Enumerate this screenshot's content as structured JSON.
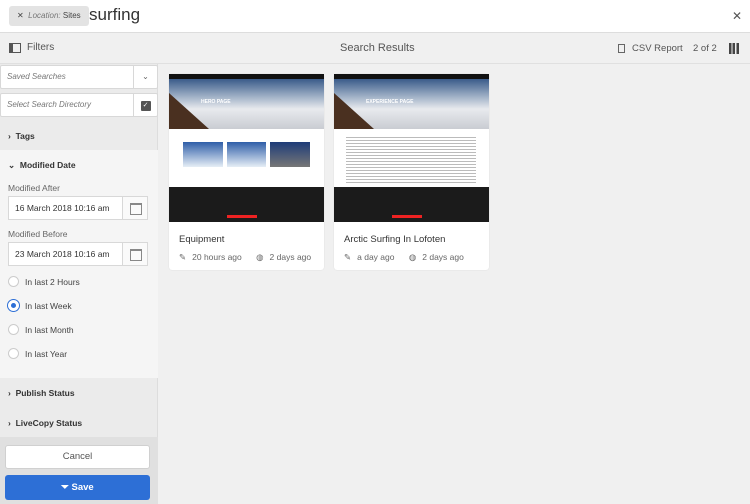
{
  "search": {
    "tag_key": "Location:",
    "tag_value": "Sites",
    "query": "surfing"
  },
  "toolbar": {
    "filters": "Filters",
    "title": "Search Results",
    "csv": "CSV Report",
    "count": "2 of 2"
  },
  "sidebar": {
    "saved_searches": "Saved Searches",
    "directory": "Select Search Directory",
    "tags": "Tags",
    "modified_date": "Modified Date",
    "after_label": "Modified After",
    "after_value": "16 March 2018 10:16 am",
    "before_label": "Modified Before",
    "before_value": "23 March 2018 10:16 am",
    "radios": [
      {
        "label": "In last 2 Hours",
        "checked": false
      },
      {
        "label": "In last Week",
        "checked": true
      },
      {
        "label": "In last Month",
        "checked": false
      },
      {
        "label": "In last Year",
        "checked": false
      }
    ],
    "publish": "Publish Status",
    "livecopy": "LiveCopy Status",
    "cancel": "Cancel",
    "save": "Save"
  },
  "colors": {
    "accent": "#2d6fd6"
  },
  "cards": [
    {
      "title": "Equipment",
      "modified": "20 hours ago",
      "published": "2 days ago",
      "thumb_label": "HERO PAGE"
    },
    {
      "title": "Arctic Surfing In Lofoten",
      "modified": "a day ago",
      "published": "2 days ago",
      "thumb_label": "EXPERIENCE PAGE"
    }
  ]
}
